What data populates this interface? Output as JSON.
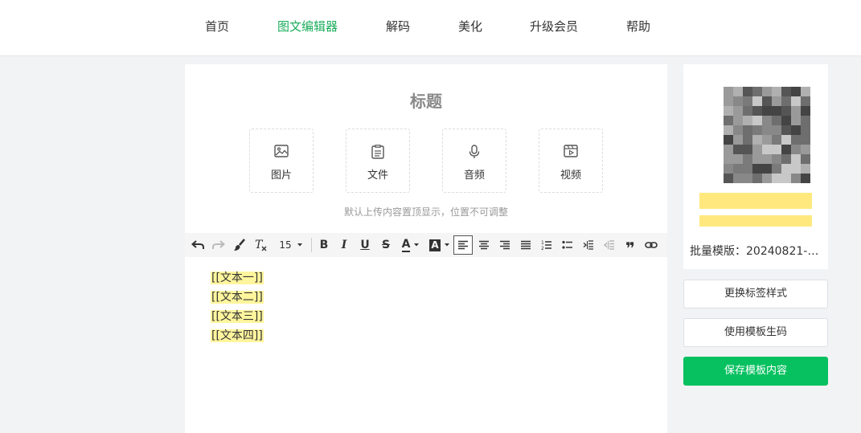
{
  "nav": {
    "items": [
      {
        "label": "首页"
      },
      {
        "label": "图文编辑器",
        "active": true
      },
      {
        "label": "解码"
      },
      {
        "label": "美化"
      },
      {
        "label": "升级会员"
      },
      {
        "label": "帮助"
      }
    ]
  },
  "editor": {
    "title": "标题",
    "uploads": [
      {
        "label": "图片",
        "icon": "image-icon"
      },
      {
        "label": "文件",
        "icon": "file-icon"
      },
      {
        "label": "音频",
        "icon": "microphone-icon"
      },
      {
        "label": "视频",
        "icon": "video-icon"
      }
    ],
    "hint": "默认上传内容置顶显示，位置不可调整",
    "toolbar": {
      "font_size": "15",
      "bold": "B",
      "italic": "I",
      "underline": "U",
      "strike": "S",
      "font_color": "A",
      "bg_color": "A",
      "quote": "❞"
    },
    "content_lines": [
      "[[文本一]]",
      "[[文本二]]",
      "[[文本三]]",
      "[[文本四]]"
    ]
  },
  "sidebar": {
    "template_name": "批量模版：20240821-8...",
    "buttons": {
      "change_style": "更换标签样式",
      "use_template": "使用模板生码",
      "save": "保存模板内容"
    }
  },
  "colors": {
    "accent": "#1aad5b",
    "primary_button": "#07c160",
    "highlight": "#fff59d"
  }
}
